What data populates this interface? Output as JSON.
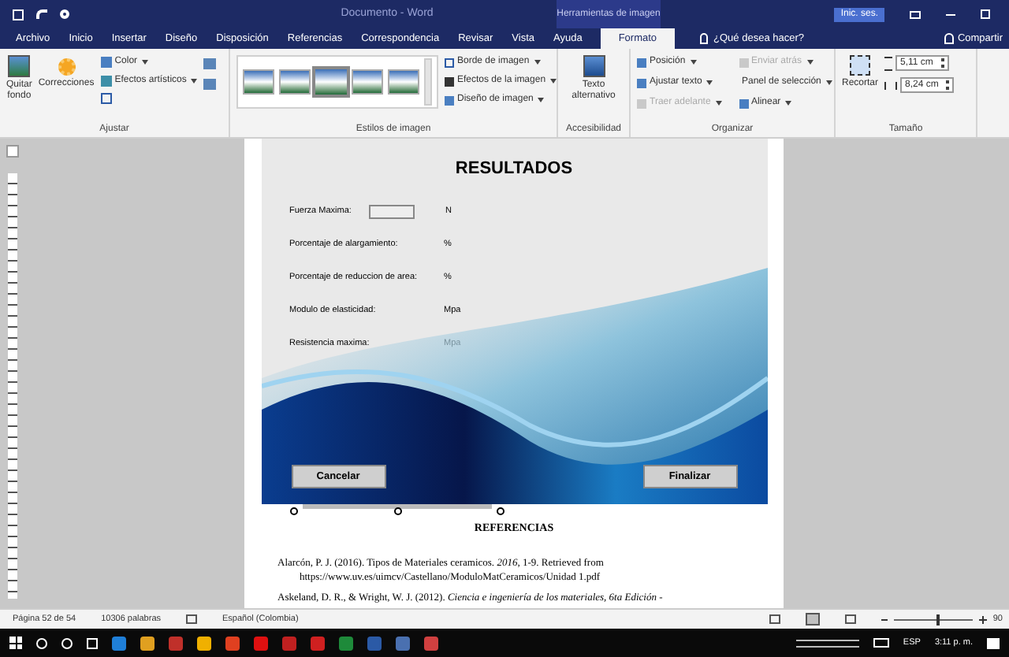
{
  "window": {
    "title": "Documento - Word",
    "context_title": "Herramientas de imagen",
    "sign_in": "Inic. ses."
  },
  "tabs": [
    {
      "label": "Archivo",
      "selected": false
    },
    {
      "label": "Inicio",
      "selected": false
    },
    {
      "label": "Insertar",
      "selected": false
    },
    {
      "label": "Diseño",
      "selected": false
    },
    {
      "label": "Disposición",
      "selected": false
    },
    {
      "label": "Referencias",
      "selected": false
    },
    {
      "label": "Correspondencia",
      "selected": false
    },
    {
      "label": "Revisar",
      "selected": false
    },
    {
      "label": "Vista",
      "selected": false
    },
    {
      "label": "Ayuda",
      "selected": false
    },
    {
      "label": "Formato",
      "selected": true
    }
  ],
  "tell_me": "¿Qué desea hacer?",
  "share": "Compartir",
  "ribbon": {
    "ajustar": {
      "label": "Ajustar",
      "remove_bg": [
        "Quitar",
        "fondo"
      ],
      "corrections": "Correcciones",
      "color_button": "Color",
      "effects": "Efectos artísticos"
    },
    "estilos": {
      "label": "Estilos de imagen",
      "styles": [
        {
          "selected": false
        },
        {
          "selected": false
        },
        {
          "selected": true
        },
        {
          "selected": false
        },
        {
          "selected": false
        }
      ],
      "border": "Borde de imagen",
      "img_effects": "Efectos de la imagen",
      "layout": "Diseño de imagen"
    },
    "accesibilidad": {
      "label": "Accesibilidad",
      "alt_text": [
        "Texto",
        "alternativo"
      ]
    },
    "organizar": {
      "label": "Organizar",
      "items": [
        {
          "label": "Posición",
          "disabled": false
        },
        {
          "label": "Enviar atrás",
          "disabled": true
        },
        {
          "label": "Ajustar texto",
          "disabled": false
        },
        {
          "label": "Panel de selección",
          "disabled": false
        },
        {
          "label": "Traer adelante",
          "disabled": true
        },
        {
          "label": "Alinear",
          "disabled": false
        }
      ]
    },
    "tamano": {
      "label": "Tamaño",
      "crop": "Recortar",
      "height": "5,11 cm",
      "width": "8,24 cm"
    }
  },
  "dialog": {
    "title": "RESULTADOS",
    "rows": [
      {
        "kind": "input",
        "label": "Fuerza Maxima:",
        "unit": "N"
      },
      {
        "kind": "plain",
        "label": "Porcentaje de alargamiento:",
        "unit": "%"
      },
      {
        "kind": "plain",
        "label": "Porcentaje de reduccion de area:",
        "unit": "%"
      },
      {
        "kind": "plain",
        "label": "Modulo de elasticidad:",
        "unit": "Mpa"
      },
      {
        "kind": "plain",
        "label": "Resistencia maxima:",
        "unit": "Mpa"
      }
    ],
    "buttons": [
      "Cancelar",
      "Finalizar"
    ]
  },
  "document": {
    "heading": "REFERENCIAS",
    "references": [
      "Alarcón, P. J. (2016). Tipos de Materiales ceramicos. *2016*, 1-9. Retrieved from https://www.uv.es/uimcv/Castellano/ModuloMatCeramicos/Unidad 1.pdf",
      "Askeland, D. R., & Wright, W. J. (2012). *Ciencia e ingeniería de los materiales, 6ta Edición* -"
    ]
  },
  "status_bar": {
    "page": "Página 52 de 54",
    "words": "10306 palabras",
    "language": "Español (Colombia)",
    "zoom": {
      "level": 0.55,
      "reading": "90"
    }
  },
  "taskbar": {
    "language": "ESP",
    "time": "3:11 p. m."
  }
}
